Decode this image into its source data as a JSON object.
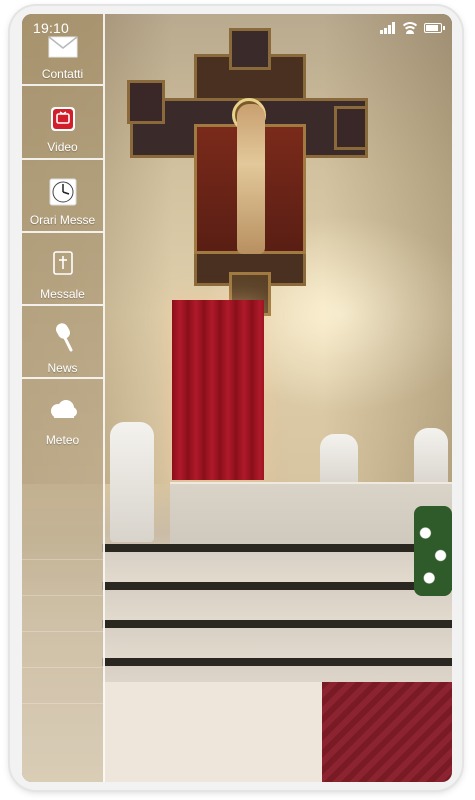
{
  "status_bar": {
    "time": "19:10",
    "icons": [
      "signal-icon",
      "wifi-icon",
      "battery-icon"
    ]
  },
  "sidebar": {
    "items": [
      {
        "label": "Contatti",
        "icon": "envelope-icon"
      },
      {
        "label": "Video",
        "icon": "video-icon"
      },
      {
        "label": "Orari Messe",
        "icon": "clock-icon"
      },
      {
        "label": "Messale",
        "icon": "book-icon"
      },
      {
        "label": "News",
        "icon": "microphone-icon"
      },
      {
        "label": "Meteo",
        "icon": "cloud-icon"
      }
    ]
  },
  "background": {
    "image": "church-altar-crucifix-photo"
  },
  "colors": {
    "sidebar": "#b09a74",
    "sidebar_divider": "#ffffff",
    "label": "#ffffff"
  }
}
